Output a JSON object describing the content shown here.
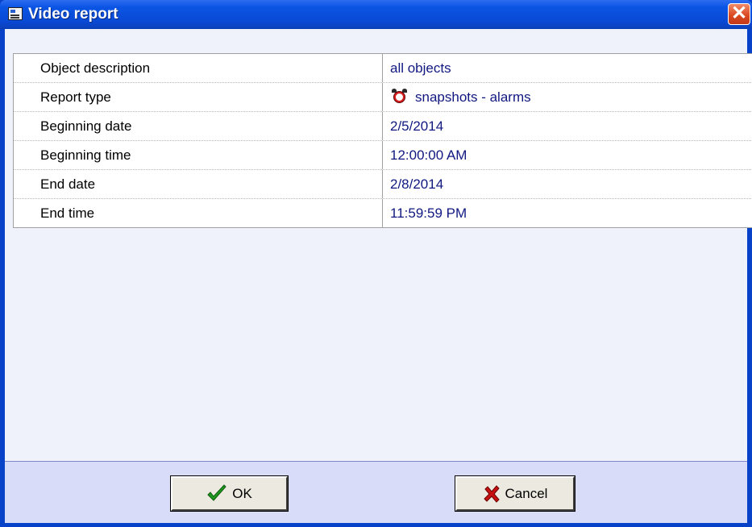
{
  "window": {
    "title": "Video report",
    "icon": "report-window-icon",
    "close_label": "✕"
  },
  "properties": [
    {
      "label": "Object description",
      "value": "all objects"
    },
    {
      "label": "Report type",
      "value": "snapshots - alarms",
      "icon": "alarm-clock-icon"
    },
    {
      "label": "Beginning date",
      "value": "2/5/2014"
    },
    {
      "label": "Beginning time",
      "value": "12:00:00 AM"
    },
    {
      "label": "End date",
      "value": "2/8/2014"
    },
    {
      "label": "End time",
      "value": "11:59:59 PM"
    }
  ],
  "buttons": {
    "ok_label": "OK",
    "ok_icon": "checkmark-icon",
    "cancel_label": "Cancel",
    "cancel_icon": "red-x-icon"
  },
  "colors": {
    "titlebar": "#0a49d4",
    "value_text": "#101880",
    "footer": "#d8dcf8",
    "checkmark": "#1e9a1e",
    "cancel_x": "#c81010"
  }
}
